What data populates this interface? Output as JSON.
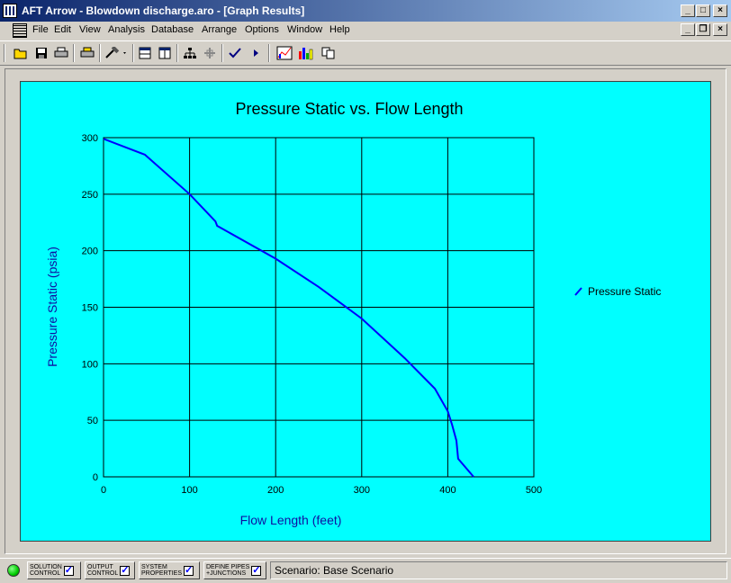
{
  "window": {
    "title": "AFT Arrow - Blowdown discharge.aro - [Graph Results]"
  },
  "menu": {
    "items": [
      "File",
      "Edit",
      "View",
      "Analysis",
      "Database",
      "Arrange",
      "Options",
      "Window",
      "Help"
    ]
  },
  "status": {
    "buttons": [
      {
        "line1": "SOLUTION",
        "line2": "CONTROL",
        "checked": true
      },
      {
        "line1": "OUTPUT",
        "line2": "CONTROL",
        "checked": true
      },
      {
        "line1": "SYSTEM",
        "line2": "PROPERTIES",
        "checked": true
      },
      {
        "line1": "DEFINE PIPES",
        "line2": "+JUNCTIONS",
        "checked": true
      }
    ],
    "scenario": "Scenario: Base Scenario"
  },
  "colors": {
    "graph_bg": "#00ffff",
    "series": "#0000ff",
    "title_bar": "#0a246a"
  },
  "chart_data": {
    "type": "line",
    "title": "Pressure Static vs. Flow Length",
    "xlabel": "Flow Length (feet)",
    "ylabel": "Pressure Static (psia)",
    "xlim": [
      0,
      500
    ],
    "ylim": [
      0,
      300
    ],
    "xticks": [
      0,
      100,
      200,
      300,
      400,
      500
    ],
    "yticks": [
      0,
      50,
      100,
      150,
      200,
      250,
      300
    ],
    "grid": true,
    "legend": "right",
    "series": [
      {
        "name": "Pressure Static",
        "x": [
          0,
          48,
          100,
          130,
          132,
          200,
          250,
          300,
          350,
          385,
          400,
          405,
          410,
          412,
          430
        ],
        "y": [
          299,
          285,
          250,
          226,
          222,
          193,
          168,
          140,
          105,
          78,
          58,
          46,
          32,
          16,
          0
        ]
      }
    ]
  }
}
